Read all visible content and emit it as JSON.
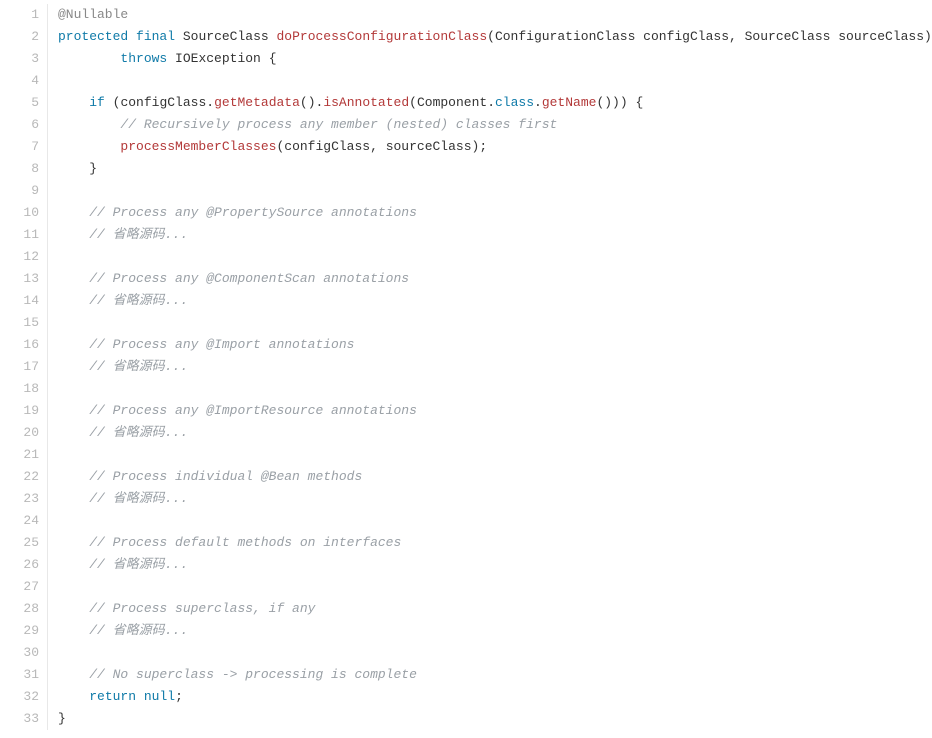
{
  "lines": {
    "l1": {
      "num": "1",
      "a": "@Nullable"
    },
    "l2": {
      "num": "2",
      "a": "protected",
      "b": "final",
      "c": "SourceClass",
      "d": "doProcessConfigurationClass",
      "e": "ConfigurationClass configClass",
      "f": "SourceClass sourceClass"
    },
    "l3": {
      "num": "3",
      "a": "throws",
      "b": "IOException",
      "c": "{"
    },
    "l4": {
      "num": "4"
    },
    "l5": {
      "num": "5",
      "a": "if",
      "b": "configClass",
      "c": "getMetadata",
      "d": "isAnnotated",
      "e": "Component",
      "f": "class",
      "g": "getName",
      "h": "{"
    },
    "l6": {
      "num": "6",
      "a": "// Recursively process any member (nested) classes first"
    },
    "l7": {
      "num": "7",
      "a": "processMemberClasses",
      "b": "configClass",
      "c": "sourceClass"
    },
    "l8": {
      "num": "8",
      "a": "}"
    },
    "l9": {
      "num": "9"
    },
    "l10": {
      "num": "10",
      "a": "// Process any @PropertySource annotations"
    },
    "l11": {
      "num": "11",
      "a": "// 省略源码..."
    },
    "l12": {
      "num": "12"
    },
    "l13": {
      "num": "13",
      "a": "// Process any @ComponentScan annotations"
    },
    "l14": {
      "num": "14",
      "a": "// 省略源码..."
    },
    "l15": {
      "num": "15"
    },
    "l16": {
      "num": "16",
      "a": "// Process any @Import annotations"
    },
    "l17": {
      "num": "17",
      "a": "// 省略源码..."
    },
    "l18": {
      "num": "18"
    },
    "l19": {
      "num": "19",
      "a": "// Process any @ImportResource annotations"
    },
    "l20": {
      "num": "20",
      "a": "// 省略源码..."
    },
    "l21": {
      "num": "21"
    },
    "l22": {
      "num": "22",
      "a": "// Process individual @Bean methods"
    },
    "l23": {
      "num": "23",
      "a": "// 省略源码..."
    },
    "l24": {
      "num": "24"
    },
    "l25": {
      "num": "25",
      "a": "// Process default methods on interfaces"
    },
    "l26": {
      "num": "26",
      "a": "// 省略源码..."
    },
    "l27": {
      "num": "27"
    },
    "l28": {
      "num": "28",
      "a": "// Process superclass, if any"
    },
    "l29": {
      "num": "29",
      "a": "// 省略源码..."
    },
    "l30": {
      "num": "30"
    },
    "l31": {
      "num": "31",
      "a": "// No superclass -> processing is complete"
    },
    "l32": {
      "num": "32",
      "a": "return",
      "b": "null",
      "c": ";"
    },
    "l33": {
      "num": "33",
      "a": "}"
    }
  }
}
